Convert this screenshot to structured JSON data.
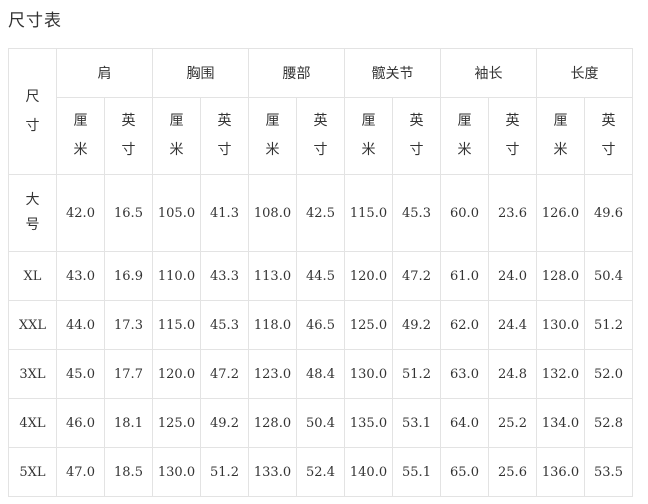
{
  "page": {
    "title": "尺寸表"
  },
  "table": {
    "size_header": [
      "尺",
      "寸"
    ],
    "groups": [
      "肩",
      "胸围",
      "腰部",
      "髋关节",
      "袖长",
      "长度"
    ],
    "units": {
      "cm": [
        "厘",
        "米"
      ],
      "inch": [
        "英",
        "寸"
      ]
    },
    "rows": [
      {
        "size": "大号",
        "size_chars": [
          "大",
          "号"
        ],
        "values": [
          "42.0",
          "16.5",
          "105.0",
          "41.3",
          "108.0",
          "42.5",
          "115.0",
          "45.3",
          "60.0",
          "23.6",
          "126.0",
          "49.6"
        ]
      },
      {
        "size": "XL",
        "values": [
          "43.0",
          "16.9",
          "110.0",
          "43.3",
          "113.0",
          "44.5",
          "120.0",
          "47.2",
          "61.0",
          "24.0",
          "128.0",
          "50.4"
        ]
      },
      {
        "size": "XXL",
        "values": [
          "44.0",
          "17.3",
          "115.0",
          "45.3",
          "118.0",
          "46.5",
          "125.0",
          "49.2",
          "62.0",
          "24.4",
          "130.0",
          "51.2"
        ]
      },
      {
        "size": "3XL",
        "values": [
          "45.0",
          "17.7",
          "120.0",
          "47.2",
          "123.0",
          "48.4",
          "130.0",
          "51.2",
          "63.0",
          "24.8",
          "132.0",
          "52.0"
        ]
      },
      {
        "size": "4XL",
        "values": [
          "46.0",
          "18.1",
          "125.0",
          "49.2",
          "128.0",
          "50.4",
          "135.0",
          "53.1",
          "64.0",
          "25.2",
          "134.0",
          "52.8"
        ]
      },
      {
        "size": "5XL",
        "values": [
          "47.0",
          "18.5",
          "130.0",
          "51.2",
          "133.0",
          "52.4",
          "140.0",
          "55.1",
          "65.0",
          "25.6",
          "136.0",
          "53.5"
        ]
      }
    ]
  }
}
